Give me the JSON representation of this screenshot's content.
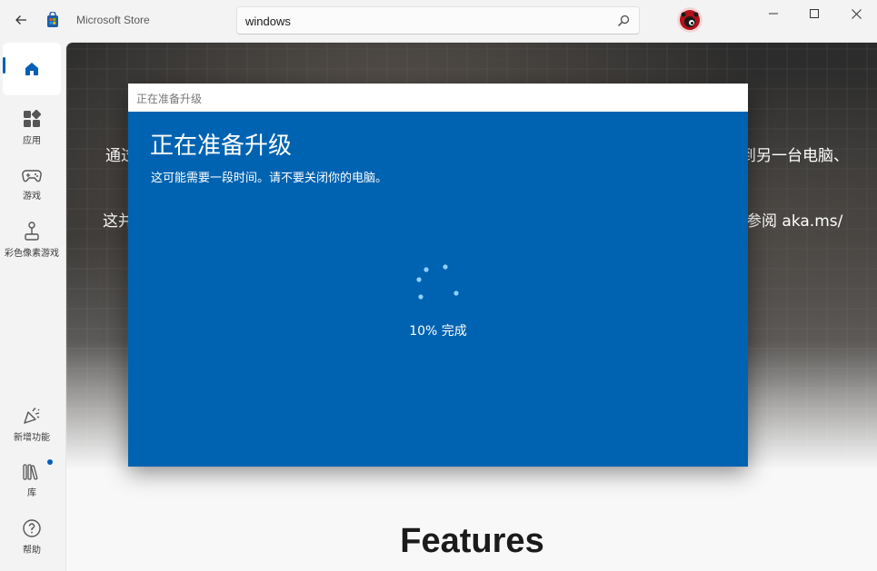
{
  "window": {
    "title": "Microsoft Store",
    "minimize_icon": "minimize-icon",
    "maximize_icon": "maximize-icon",
    "close_icon": "close-icon"
  },
  "search": {
    "value": "windows",
    "placeholder": ""
  },
  "sidebar": {
    "items": [
      {
        "id": "home",
        "label": "",
        "icon": "home-icon"
      },
      {
        "id": "apps",
        "label": "应用",
        "icon": "apps-icon"
      },
      {
        "id": "games",
        "label": "游戏",
        "icon": "gamepad-icon"
      },
      {
        "id": "arcade",
        "label": "彩色像素游戏",
        "icon": "joystick-icon"
      },
      {
        "id": "whats-new",
        "label": "新增功能",
        "icon": "party-popper-icon"
      },
      {
        "id": "library",
        "label": "库",
        "icon": "library-icon"
      },
      {
        "id": "help",
        "label": "帮助",
        "icon": "help-icon"
      }
    ],
    "accent": "#005fb8"
  },
  "hero": {
    "line1_left": "通过",
    "line1_right": "到另一台电脑、",
    "line2_left": "这并",
    "line2_right": "参阅 aka.ms/"
  },
  "features_heading": "Features",
  "dialog": {
    "window_title": "正在准备升级",
    "heading": "正在准备升级",
    "subtitle": "这可能需要一段时间。请不要关闭你的电脑。",
    "progress_label": "10% 完成",
    "progress_fraction": 0.1,
    "accent": "#0063b1"
  }
}
